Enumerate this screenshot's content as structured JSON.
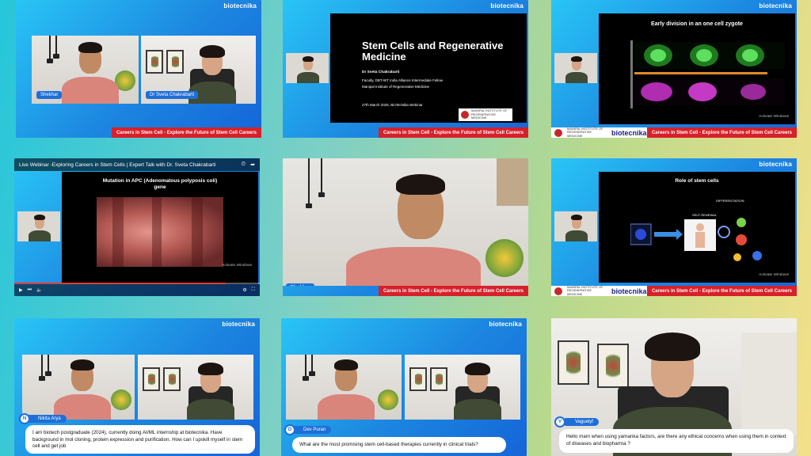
{
  "brand": "biotecnika",
  "banner": "Careers in Stem Cell - Explore the Future of Stem Cell Careers",
  "institute_logo_text": "MANIPAL INSTITUTE OF REGENERATIVE MEDICINE",
  "activate_windows": "Activate Windows",
  "activate_windows_sub": "Go to Settings to activate Windows.",
  "participants": {
    "host": "Shekhar",
    "speaker": "Dr Sveta Chakrabarti"
  },
  "tile2_slide": {
    "title": "Stem Cells and Regenerative Medicine",
    "author": "Dr Sveta Chakrabarti",
    "role": "Faculty, DBT-WT India Alliance Intermediate Fellow",
    "institute": "Manipal Institute of Regenerative Medicine",
    "date": "27th March 2025, BioTecNika Webinar"
  },
  "tile3_slide": {
    "title": "Early division in an one cell zygote"
  },
  "tile4": {
    "video_title": "Live Webinar -Exploring Careers in Stem Cells | Expert Talk with Dr. Sveta Chakrabarti",
    "slide_title": "Mutation in APC (Adenomatous polyposis coli) gene",
    "progress": 0.86
  },
  "tile6_slide": {
    "title": "Role of stem cells",
    "self_renewal": "SELF-RENEWAL",
    "differentiation": "DIFFERENTIATION"
  },
  "comments": [
    {
      "name": "Nikita Arya",
      "initials": "N",
      "text": "I am biotech postgraduate (2024), currently doing AI/ML internship at biotecnika. Have background in mol cloning, protein expression and purification. How can I upskill myself in stem cell and get job"
    },
    {
      "name": "Dev Puran",
      "initials": "D",
      "text": "What are the most promising stem cell-based therapies currently in clinical trials?"
    },
    {
      "name": "Vaguelyf",
      "initials": "V",
      "text": "Hello mam when using yamanka factors, are there any ethical concerns when using them in context of diseases and biopharma ?"
    }
  ],
  "colors": {
    "accent": "#1e6fd8",
    "banner": "#d8202a"
  }
}
